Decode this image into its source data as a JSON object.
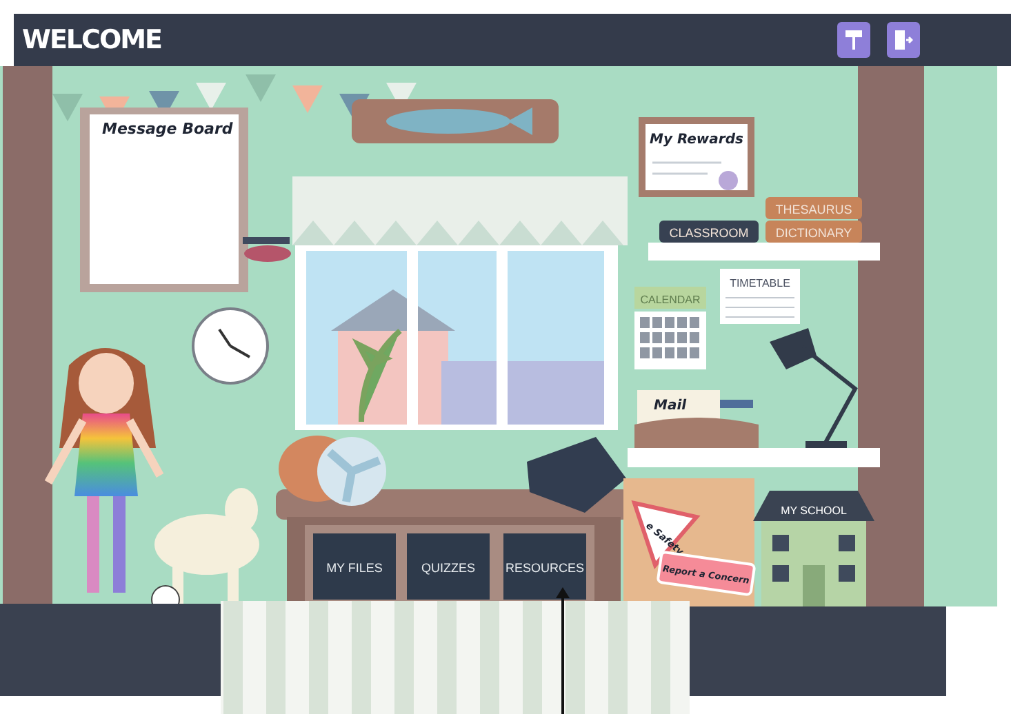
{
  "header": {
    "title": "WELCOME"
  },
  "scene": {
    "message_board": {
      "title": "Message Board"
    },
    "rewards": {
      "title": "My Rewards"
    },
    "books": [
      {
        "label": "CLASSROOM",
        "color": "#374152"
      },
      {
        "label": "THESAURUS",
        "color": "#c7845a"
      },
      {
        "label": "DICTIONARY",
        "color": "#c7845a"
      }
    ],
    "calendar": {
      "label": "CALENDAR"
    },
    "timetable": {
      "label": "TIMETABLE"
    },
    "mail": {
      "label": "Mail"
    },
    "esafety": {
      "label": "e Safety"
    },
    "report": {
      "label": "Report a Concern"
    },
    "school": {
      "label": "MY SCHOOL"
    },
    "drawers": [
      "MY FILES",
      "QUIZZES",
      "RESOURCES"
    ]
  }
}
